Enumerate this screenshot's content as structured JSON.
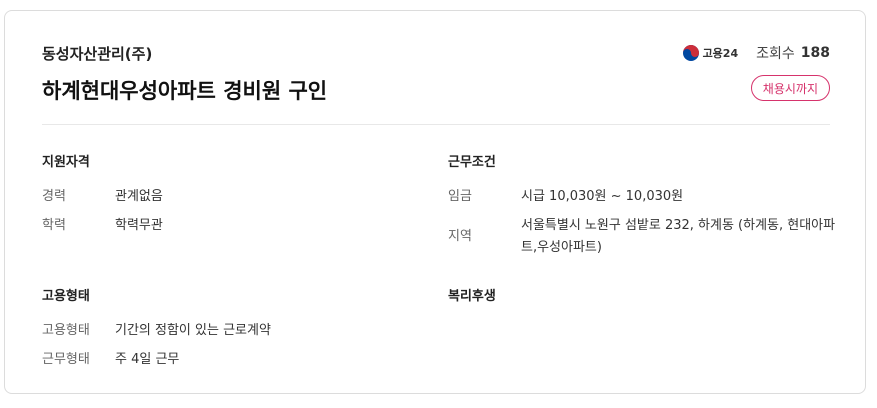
{
  "header": {
    "company": "동성자산관리(주)",
    "title": "하계현대우성아파트 경비원 구인",
    "source_logo_text": "고용24",
    "views_label": "조회수",
    "views_count": "188",
    "deadline_button": "채용시까지"
  },
  "support": {
    "title": "지원자격",
    "rows": [
      {
        "label": "경력",
        "value": "관계없음"
      },
      {
        "label": "학력",
        "value": "학력무관"
      }
    ]
  },
  "conditions": {
    "title": "근무조건",
    "rows": [
      {
        "label": "임금",
        "value": "시급 10,030원 ~ 10,030원"
      },
      {
        "label": "지역",
        "value": "서울특별시 노원구 섬밭로 232, 하계동 (하계동, 현대아파트,우성아파트)"
      }
    ]
  },
  "employment": {
    "title": "고용형태",
    "rows": [
      {
        "label": "고용형태",
        "value": "기간의 정함이 있는 근로계약"
      },
      {
        "label": "근무형태",
        "value": "주 4일 근무"
      }
    ]
  },
  "benefits": {
    "title": "복리후생"
  },
  "colors": {
    "accent": "#d6336c",
    "logo_red": "#cd2e3a",
    "logo_blue": "#0047a0"
  }
}
